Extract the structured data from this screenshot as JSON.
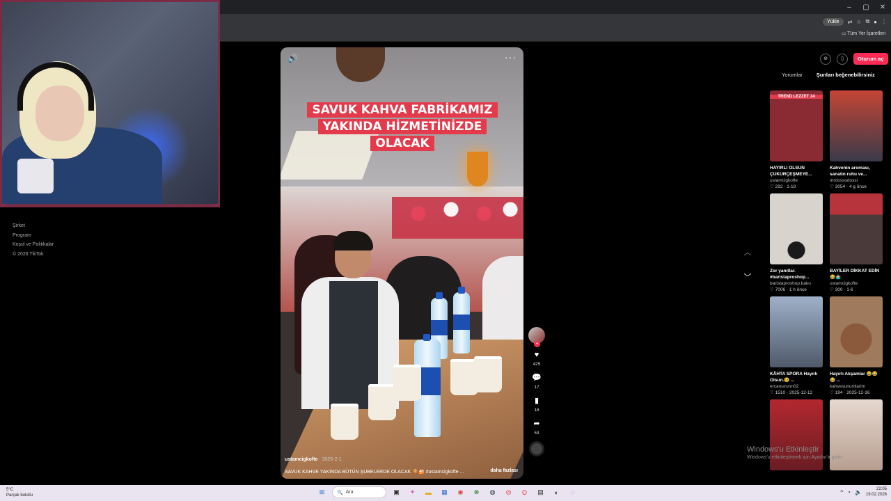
{
  "browser": {
    "toolbar_buttons": [
      "Yükle"
    ],
    "bookmarks_label": "Tüm Yer İşaretleri",
    "window_controls": [
      "–",
      "▢",
      "✕"
    ]
  },
  "sidebar_footer": {
    "links": [
      "Şirket",
      "Program",
      "Koşul ve Politikalar"
    ],
    "copyright": "© 2026 TikTok"
  },
  "video": {
    "caption_lines": [
      "SAVUK KAHVA FABRİKAMIZ",
      "YAKINDA HİZMETİNİZDE",
      "OLACAK"
    ],
    "author": "ustamcigkofte",
    "date": "· 2025-2-1",
    "description": "SAVUK KAHVE YAKINDA BÜTÜN ŞUBELERDE OLACAK 🍪🍰 #ustamcigkofte ...",
    "more_label": "daha fazlası",
    "sound_icon": "speaker-icon",
    "more_icon": "···"
  },
  "actions": {
    "likes": "425",
    "comments": "17",
    "saves": "18",
    "shares": "53"
  },
  "header_right": {
    "login_label": "Oturum aç"
  },
  "right_tabs": [
    "Yorumlar",
    "Şunları beğenebilirsiniz"
  ],
  "cards": [
    {
      "title": "HAYIRLI OLSUN ÇUKURÇEŞMEYE...",
      "user": "ustamcigkofte",
      "meta": "♡ 292 · 1-18",
      "thumb_label": "TREND LEZZET 34",
      "color": "#8a2a33"
    },
    {
      "title": "Kahvenin aroması, sanatın ruhu ve...",
      "user": "mrdossodossi",
      "meta": "♡ 3054 · 4 g önce",
      "thumb_label": "",
      "color": "#b83a30"
    },
    {
      "title": "Zor yanıtlar. #baristaproshop...",
      "user": "baristaproshop.baku",
      "meta": "♡ 7006 · 1 h önce",
      "thumb_label": "",
      "color": "#d8d3cc"
    },
    {
      "title": "BAYİLER DİKKAT EDİN 😂🤷🏻‍♂️",
      "user": "ustamcigkofte",
      "meta": "♡ 300 · 1-6",
      "thumb_label": "",
      "color": "#4a3a3a"
    },
    {
      "title": "KÂHTA SPORA Hayırlı Olsun.😉 ...",
      "user": "ercanuzunn02",
      "meta": "♡ 1510 · 2025-12-12",
      "thumb_label": "",
      "color": "#7e8aa0"
    },
    {
      "title": "Hayırlı Akşamlar 😂😂😂 ...",
      "user": "kahvesunumlarim",
      "meta": "♡ 194 · 2025-12-16",
      "thumb_label": "",
      "color": "#a07a5c"
    },
    {
      "title": "",
      "user": "",
      "meta": "",
      "thumb_label": "",
      "color": "#b3282f"
    },
    {
      "title": "",
      "user": "",
      "meta": "",
      "thumb_label": "",
      "color": "#d8c3b8"
    }
  ],
  "watermark": {
    "title": "Windows'u Etkinleştir",
    "subtitle": "Windows'u etkinleştirmek için Ayarlar'a gidin."
  },
  "taskbar": {
    "weather_temp": "5°C",
    "weather_desc": "Parçalı bulutlu",
    "search_placeholder": "Ara",
    "time": "22:05",
    "date": "19.02.2026"
  }
}
